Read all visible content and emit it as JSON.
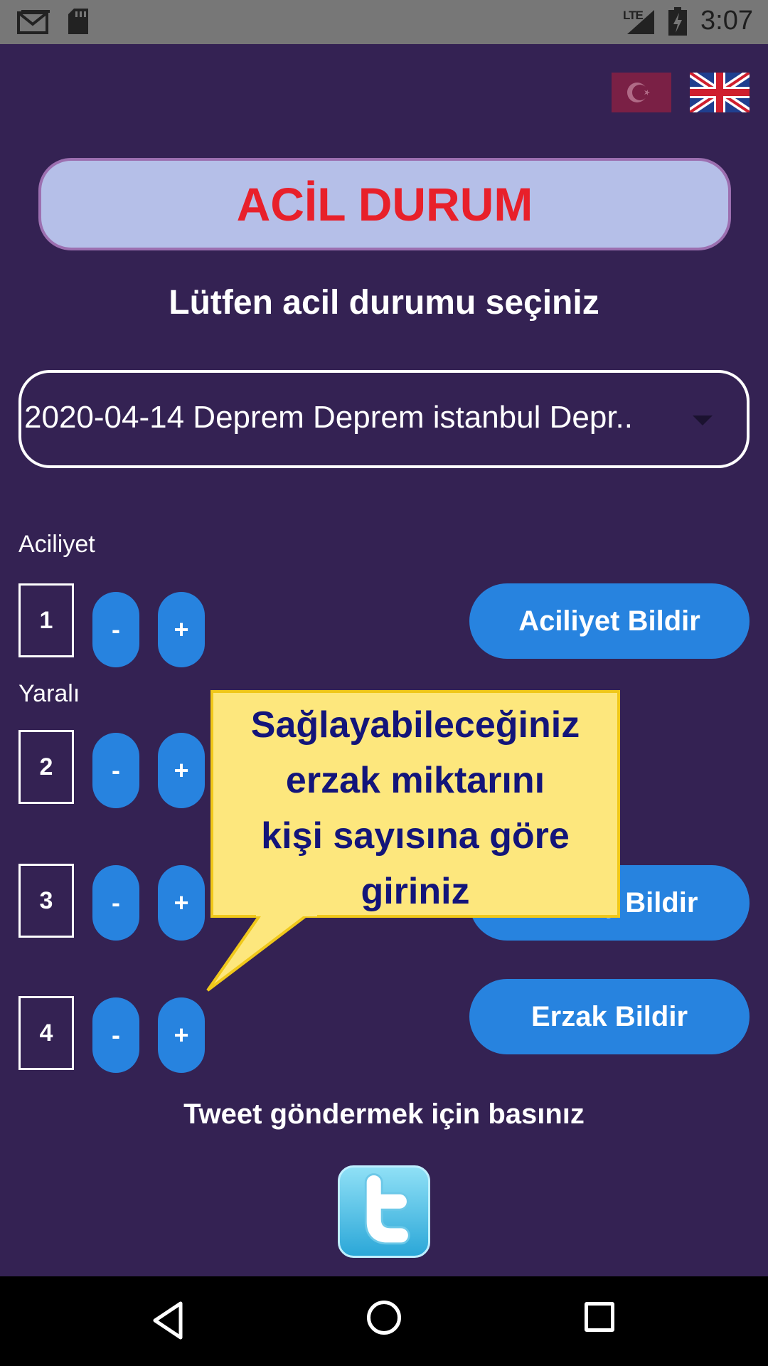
{
  "status_bar": {
    "time": "3:07",
    "network": "LTE",
    "icons": [
      "gmail-icon",
      "sd-card-icon",
      "signal-icon",
      "battery-icon"
    ]
  },
  "flags": {
    "turkish": "turkish-flag-icon",
    "english": "uk-flag-icon"
  },
  "title": "ACİL DURUM",
  "subtitle": "Lütfen acil durumu seçiniz",
  "emergency_select": {
    "selected": "2020-04-14 Deprem Deprem istanbul Depr.."
  },
  "sections": [
    {
      "label": "Aciliyet",
      "value": "1",
      "button": "Aciliyet Bildir"
    },
    {
      "label": "Yaralı",
      "value": "2",
      "button": ""
    },
    {
      "label": "",
      "value": "3",
      "button": "Barınış Bildir"
    },
    {
      "label": "",
      "value": "4",
      "button": "Erzak Bildir"
    }
  ],
  "controls": {
    "minus": "-",
    "plus": "+"
  },
  "tooltip": {
    "lines": [
      "Sağlayabileceğiniz",
      "erzak miktarını",
      "kişi sayısına göre",
      "giriniz"
    ]
  },
  "tweet_label": "Tweet göndermek için basınız",
  "colors": {
    "background": "#342253",
    "accent_blue": "#2783df",
    "title_red": "#e8202a",
    "tooltip_bg": "#fde77d",
    "tooltip_text": "#13157a"
  }
}
